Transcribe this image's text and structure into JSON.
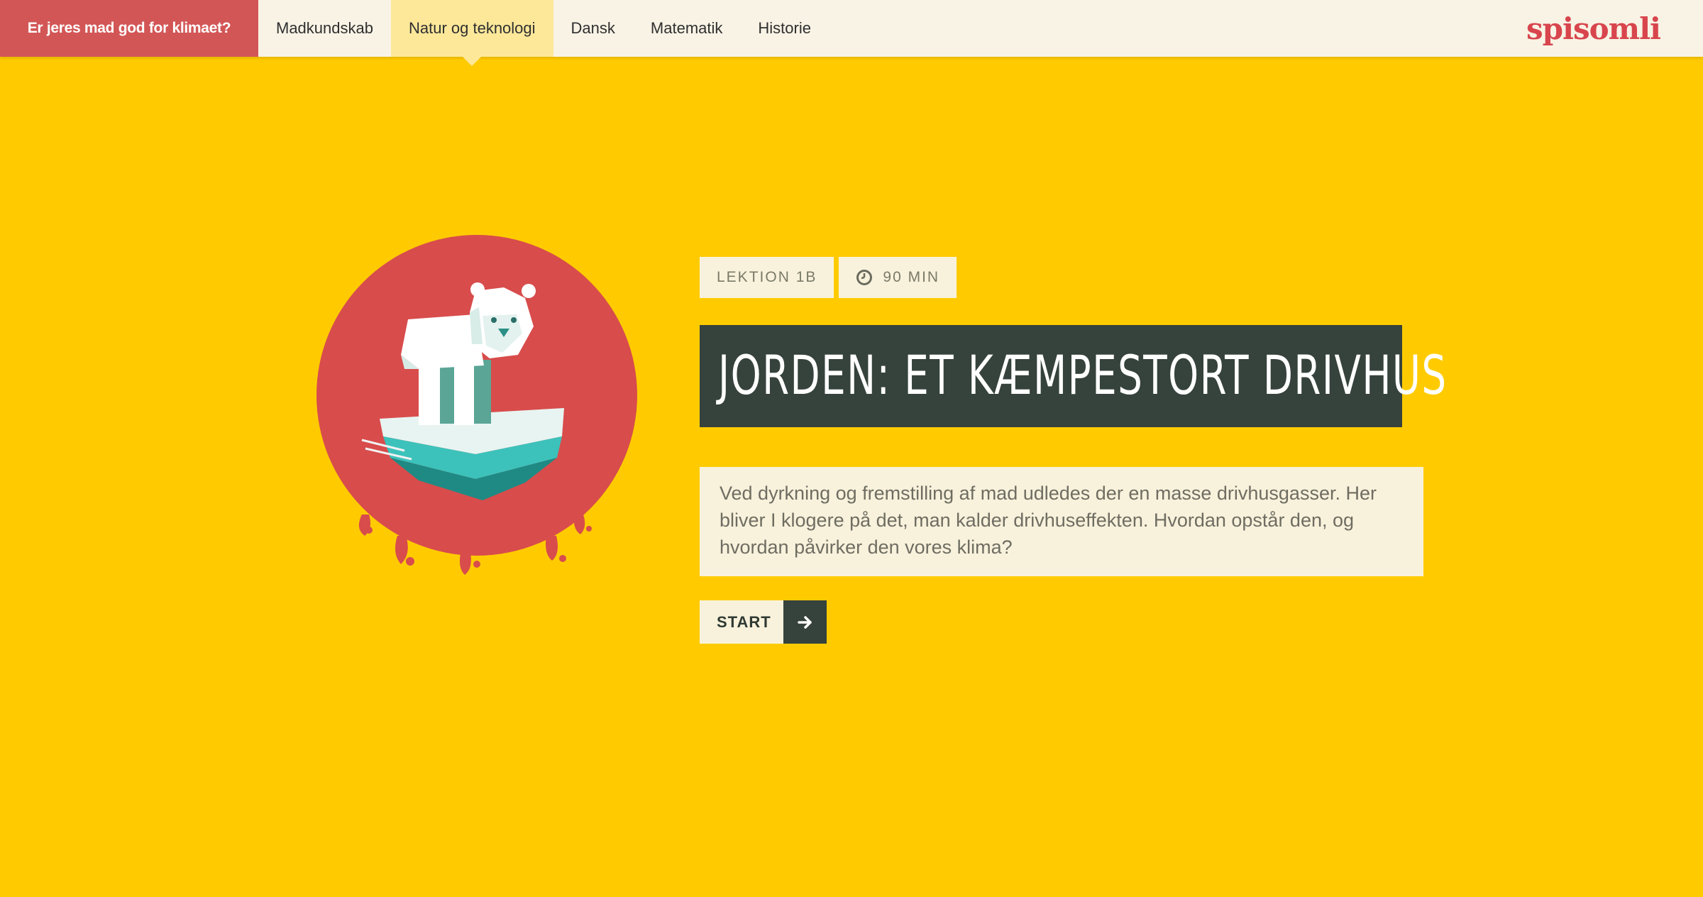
{
  "header": {
    "brand_tab": "Er jeres mad god for klimaet?",
    "nav_items": [
      {
        "label": "Madkundskab",
        "active": false
      },
      {
        "label": "Natur og teknologi",
        "active": true
      },
      {
        "label": "Dansk",
        "active": false
      },
      {
        "label": "Matematik",
        "active": false
      },
      {
        "label": "Historie",
        "active": false
      }
    ],
    "logo_text": "spisomli"
  },
  "lesson": {
    "lesson_tag": "LEKTION 1B",
    "duration_tag": "90 MIN",
    "title": "JORDEN: ET KÆMPESTORT DRIVHUS",
    "description": "Ved dyrkning og fremstilling af mad udledes der en masse drivhusgasser. Her bliver I klogere på det, man kalder drivhuseffekten. Hvordan opstår den, og hvordan påvirker den vores klima?",
    "start_label": "START"
  },
  "icons": {
    "clock": "clock-icon",
    "arrow": "arrow-right-icon",
    "illustration": "polar-bear-on-melting-ice-illustration"
  },
  "colors": {
    "background": "#ffcb00",
    "brand_red": "#d35656",
    "nav_bg": "#f8f3e5",
    "active_tab": "#fde89a",
    "title_bg": "#36423c",
    "box_bg": "#f8f2dc",
    "logo": "#d8454d"
  }
}
